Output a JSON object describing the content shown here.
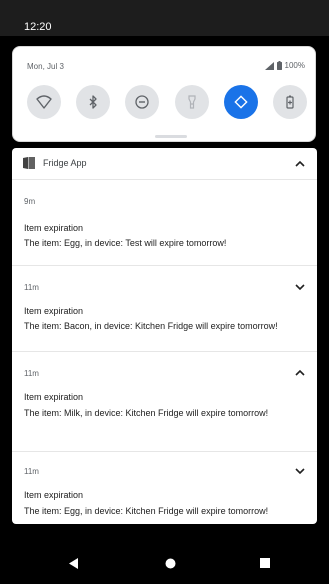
{
  "status_bar": {
    "time": "12:20"
  },
  "quick_settings": {
    "date": "Mon, Jul 3",
    "battery_percent": "100%",
    "tiles": [
      {
        "name": "wifi-icon",
        "active": false
      },
      {
        "name": "bluetooth-icon",
        "active": false
      },
      {
        "name": "do-not-disturb-icon",
        "active": false
      },
      {
        "name": "flashlight-icon",
        "active": false
      },
      {
        "name": "auto-rotate-icon",
        "active": true
      },
      {
        "name": "battery-saver-icon",
        "active": false
      }
    ],
    "accent_color": "#1a73e8"
  },
  "notification_group": {
    "app_name": "Fridge App",
    "app_icon": "fridge-app-icon",
    "expanded": true,
    "notifications": [
      {
        "time": "9m",
        "title": "Item expiration",
        "text": "The item: Egg, in device: Test will expire tomorrow!",
        "expanded": true
      },
      {
        "time": "11m",
        "title": "Item expiration",
        "text": "The item: Bacon, in device: Kitchen Fridge will expire tomorrow!",
        "expanded": false
      },
      {
        "time": "11m",
        "title": "Item expiration",
        "text": "The item: Milk, in device: Kitchen Fridge will expire tomorrow!",
        "expanded": true
      },
      {
        "time": "11m",
        "title": "Item expiration",
        "text": "The item: Egg, in device: Kitchen Fridge will expire tomorrow!",
        "expanded": false
      }
    ]
  },
  "navigation": {
    "buttons": [
      "back-icon",
      "home-icon",
      "recents-icon"
    ]
  }
}
